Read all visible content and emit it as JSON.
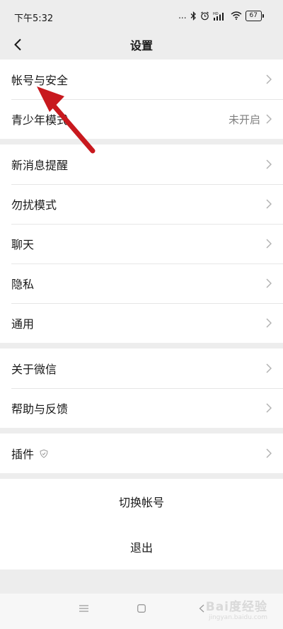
{
  "status_bar": {
    "time": "下午5:32",
    "signal_dots": "...",
    "hd_label": "HD",
    "battery": "67"
  },
  "nav": {
    "title": "设置"
  },
  "groups": [
    {
      "items": [
        {
          "label": "帐号与安全",
          "value": ""
        },
        {
          "label": "青少年模式",
          "value": "未开启"
        }
      ]
    },
    {
      "items": [
        {
          "label": "新消息提醒",
          "value": ""
        },
        {
          "label": "勿扰模式",
          "value": ""
        },
        {
          "label": "聊天",
          "value": ""
        },
        {
          "label": "隐私",
          "value": ""
        },
        {
          "label": "通用",
          "value": ""
        }
      ]
    },
    {
      "items": [
        {
          "label": "关于微信",
          "value": ""
        },
        {
          "label": "帮助与反馈",
          "value": ""
        }
      ]
    },
    {
      "items": [
        {
          "label": "插件",
          "value": ""
        }
      ]
    }
  ],
  "actions": {
    "switch_account": "切换帐号",
    "logout": "退出"
  },
  "watermark": {
    "text": "Bai度经验",
    "sub": "jingyan.baidu.com"
  },
  "colors": {
    "background": "#ededed",
    "annotation_arrow": "#c8191e"
  }
}
